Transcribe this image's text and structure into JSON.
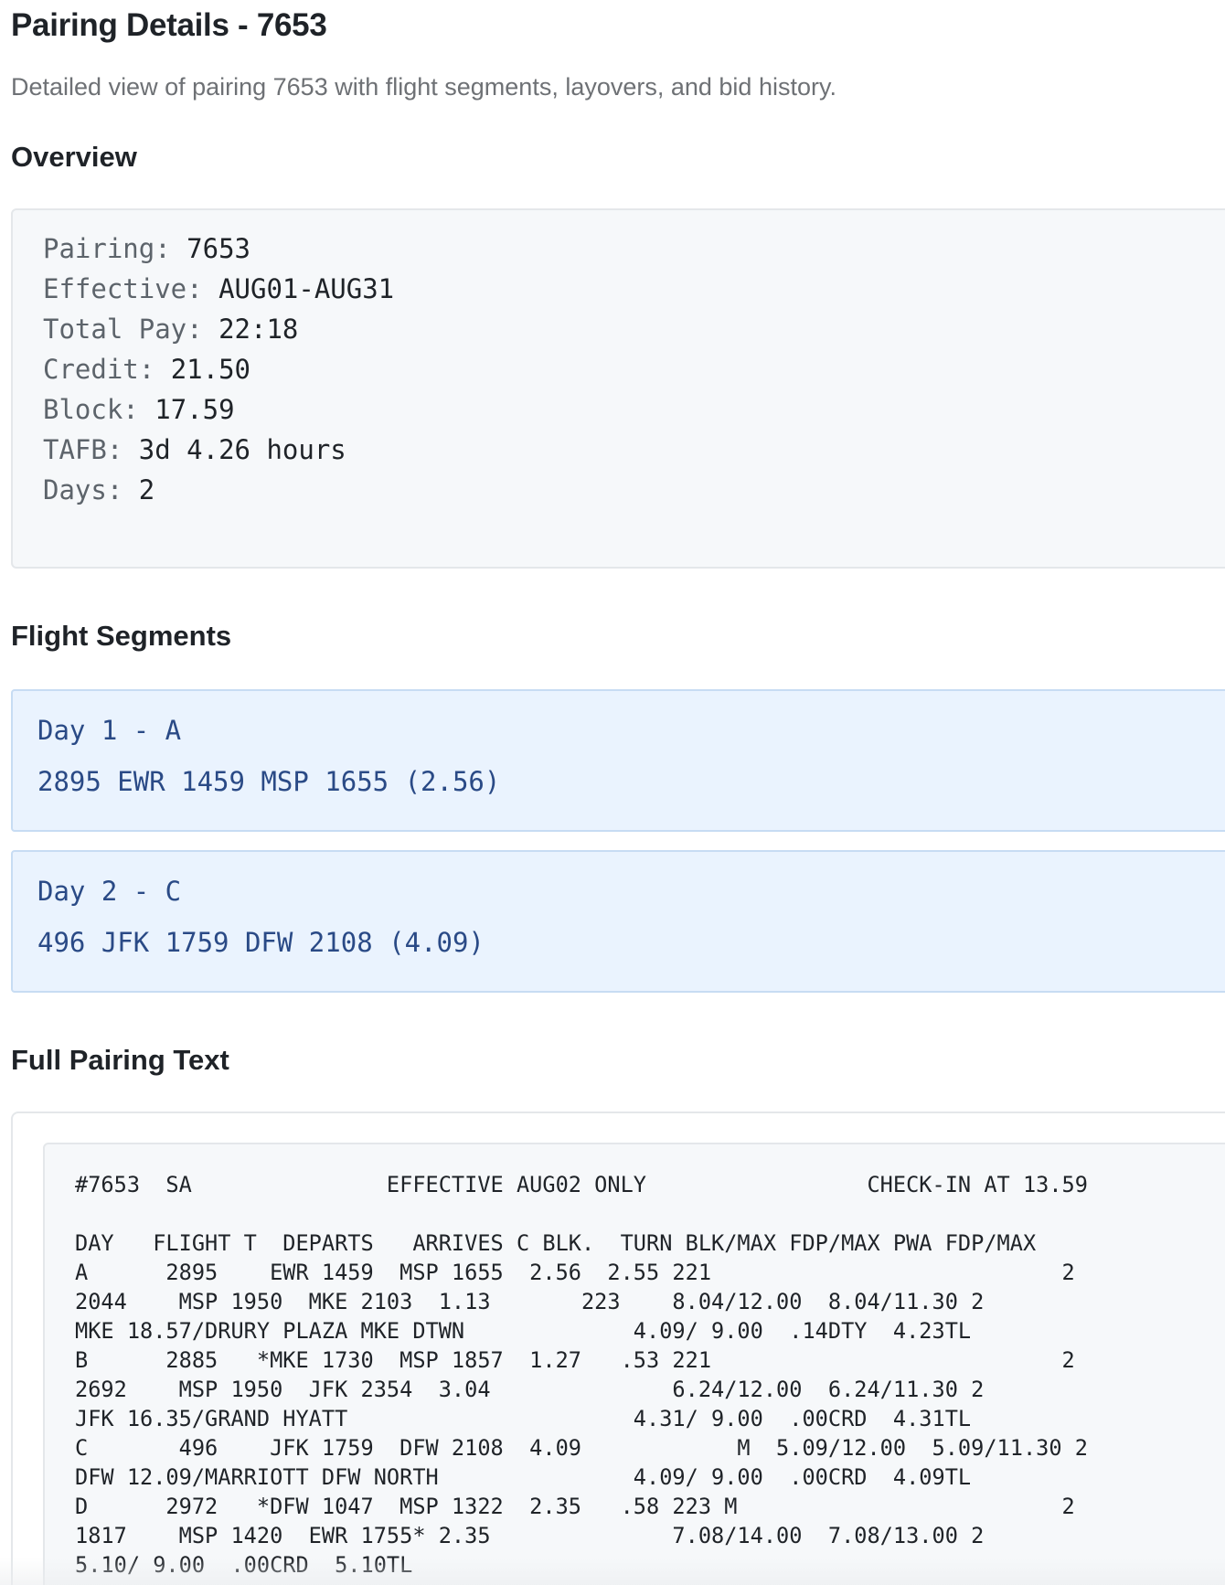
{
  "page": {
    "title": "Pairing Details - 7653",
    "subtitle": "Detailed view of pairing 7653 with flight segments, layovers, and bid history."
  },
  "sections": {
    "overview": "Overview",
    "segments": "Flight Segments",
    "full_text": "Full Pairing Text"
  },
  "overview": [
    {
      "label": "Pairing:",
      "value": "7653"
    },
    {
      "label": "Effective:",
      "value": "AUG01-AUG31"
    },
    {
      "label": "Total Pay:",
      "value": "22:18"
    },
    {
      "label": "Credit:",
      "value": "21.50"
    },
    {
      "label": "Block:",
      "value": "17.59"
    },
    {
      "label": "TAFB:",
      "value": "3d 4.26 hours"
    },
    {
      "label": "Days:",
      "value": "2"
    }
  ],
  "segments": [
    {
      "title": "Day 1 - A",
      "flight": "2895 EWR 1459 MSP 1655 (2.56)"
    },
    {
      "title": "Day 2 - C",
      "flight": "496 JFK 1759 DFW 2108 (4.09)"
    }
  ],
  "full_text": {
    "lines": [
      "#7653  SA               EFFECTIVE AUG02 ONLY                 CHECK-IN AT 13.59",
      "DAY   FLIGHT T  DEPARTS   ARRIVES C BLK.  TURN BLK/MAX FDP/MAX PWA FDP/MAX",
      "A      2895    EWR 1459  MSP 1655  2.56  2.55 221                           2",
      "2044    MSP 1950  MKE 2103  1.13       223    8.04/12.00  8.04/11.30 2",
      "MKE 18.57/DRURY PLAZA MKE DTWN             4.09/ 9.00  .14DTY  4.23TL",
      "B      2885   *MKE 1730  MSP 1857  1.27   .53 221                           2",
      "2692    MSP 1950  JFK 2354  3.04              6.24/12.00  6.24/11.30 2",
      "JFK 16.35/GRAND HYATT                      4.31/ 9.00  .00CRD  4.31TL",
      "C       496    JFK 1759  DFW 2108  4.09            M  5.09/12.00  5.09/11.30 2",
      "DFW 12.09/MARRIOTT DFW NORTH               4.09/ 9.00  .00CRD  4.09TL",
      "D      2972   *DFW 1047  MSP 1322  2.35   .58 223 M                         2",
      "1817    MSP 1420  EWR 1755* 2.35              7.08/14.00  7.08/13.00 2",
      "5.10/ 9.00  .00CRD  5.10TL"
    ]
  },
  "colors": {
    "segment_bg": "#eaf3fe",
    "segment_text": "#2a4a86",
    "code_bg": "#f6f8fa",
    "muted_text": "#6e7175"
  }
}
